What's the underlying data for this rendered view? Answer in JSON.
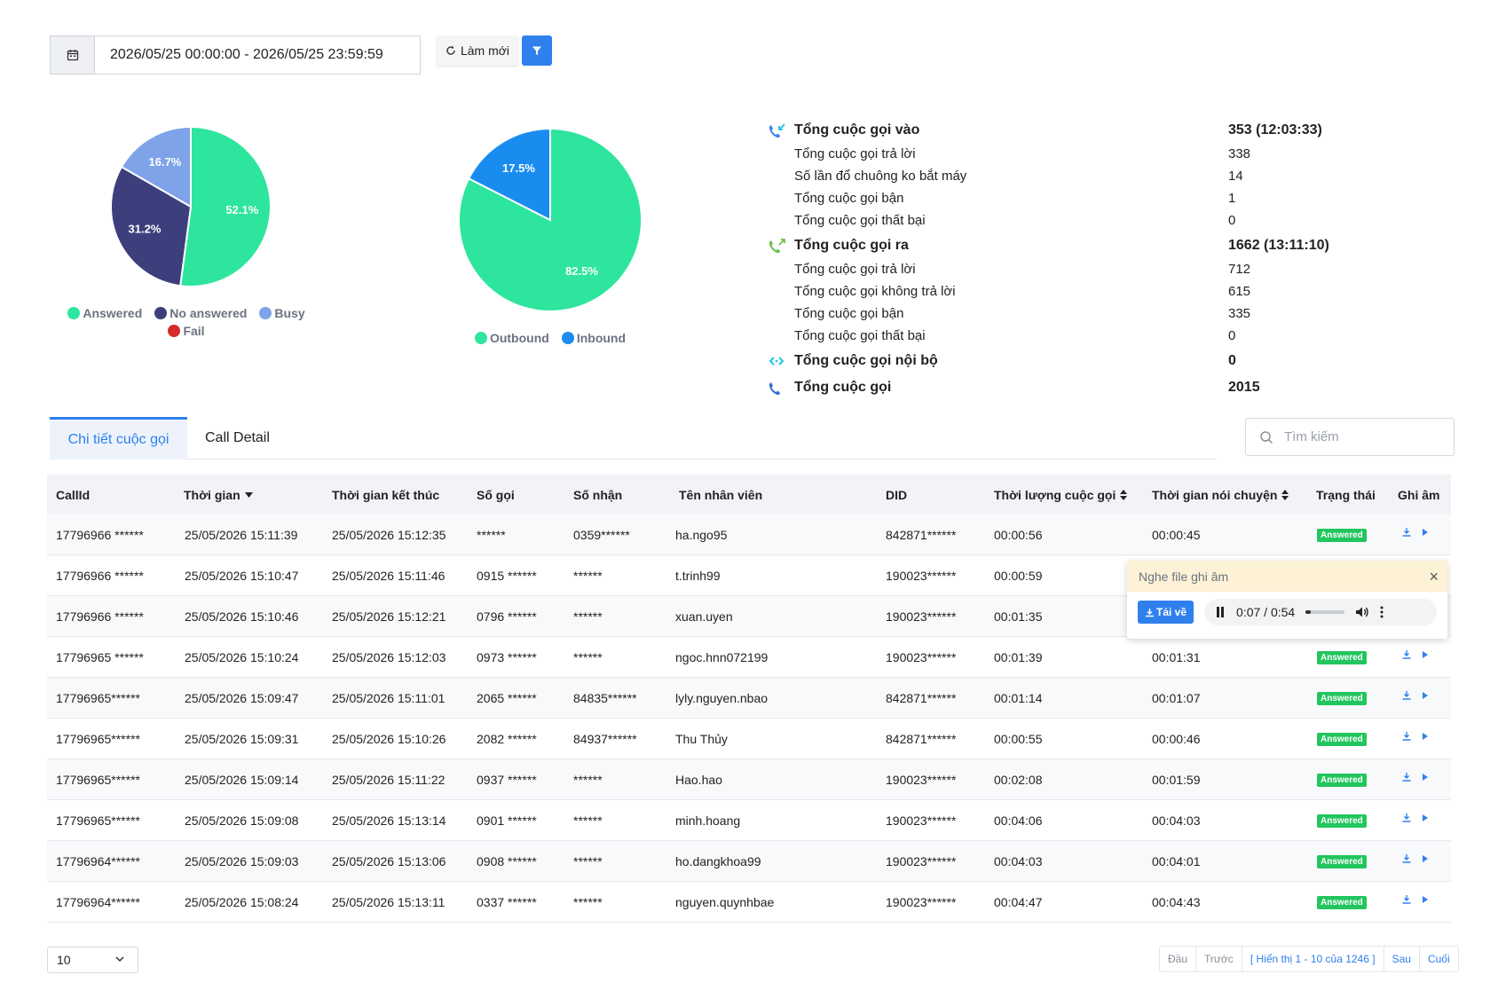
{
  "toolbar": {
    "date_range": "2026/05/25 00:00:00 - 2026/05/25 23:59:59",
    "refresh_label": "Làm mới"
  },
  "charts": {
    "status": {
      "slices": [
        {
          "name": "Answered",
          "pct": 52.1,
          "label": "52.1%",
          "color": "#2ee59d"
        },
        {
          "name": "No answered",
          "pct": 31.2,
          "label": "31.2%",
          "color": "#3d3f7d"
        },
        {
          "name": "Busy",
          "pct": 16.7,
          "label": "16.7%",
          "color": "#7ea3e8"
        },
        {
          "name": "Fail",
          "pct": 0,
          "label": "",
          "color": "#d62b2b"
        }
      ]
    },
    "direction": {
      "slices": [
        {
          "name": "Outbound",
          "pct": 82.5,
          "label": "82.5%",
          "color": "#2ee59d"
        },
        {
          "name": "Inbound",
          "pct": 17.5,
          "label": "17.5%",
          "color": "#1a8cf0"
        }
      ]
    }
  },
  "chart_data": [
    {
      "type": "pie",
      "categories": [
        "Answered",
        "No answered",
        "Busy",
        "Fail"
      ],
      "values": [
        52.1,
        31.2,
        16.7,
        0
      ],
      "title": "",
      "legend": "bottom"
    },
    {
      "type": "pie",
      "categories": [
        "Outbound",
        "Inbound"
      ],
      "values": [
        82.5,
        17.5
      ],
      "title": "",
      "legend": "bottom"
    }
  ],
  "stats": [
    {
      "label": "Tổng cuộc gọi vào",
      "value": "353 (12:03:33)",
      "head": true,
      "icon": "incoming-call-icon"
    },
    {
      "label": "Tổng cuộc gọi trả lời",
      "value": "338",
      "head": false
    },
    {
      "label": "Số lần đổ chuông ko bắt máy",
      "value": "14",
      "head": false
    },
    {
      "label": "Tổng cuộc gọi bận",
      "value": "1",
      "head": false
    },
    {
      "label": "Tổng cuộc gọi thất bại",
      "value": "0",
      "head": false
    },
    {
      "label": "Tổng cuộc gọi ra",
      "value": "1662 (13:11:10)",
      "head": true,
      "icon": "outgoing-call-icon"
    },
    {
      "label": "Tổng cuộc gọi trả lời",
      "value": "712",
      "head": false
    },
    {
      "label": "Tổng cuộc gọi không trả lời",
      "value": "615",
      "head": false
    },
    {
      "label": "Tổng cuộc gọi bận",
      "value": "335",
      "head": false
    },
    {
      "label": "Tổng cuộc gọi thất bại",
      "value": "0",
      "head": false
    },
    {
      "label": "Tổng cuộc gọi nội bộ",
      "value": "0",
      "head": true,
      "icon": "internal-call-icon"
    },
    {
      "label": "Tổng cuộc gọi",
      "value": "2015",
      "head": true,
      "icon": "phone-icon"
    }
  ],
  "tabs": {
    "active": "Chi tiết cuộc gọi",
    "other": "Call Detail"
  },
  "search": {
    "placeholder": "Tìm kiếm"
  },
  "table": {
    "headers": {
      "callid": "CallId",
      "time": "Thời gian",
      "end": "Thời gian kết thúc",
      "caller": "Số gọi",
      "callee": "Số nhận",
      "agent": "Tên nhân viên",
      "did": "DID",
      "duration": "Thời lượng cuộc gọi",
      "talk": "Thời gian nói chuyện",
      "status": "Trạng thái",
      "record": "Ghi âm"
    },
    "rows": [
      {
        "callid": "17796966 ******",
        "time": "25/05/2026 15:11:39",
        "end": "25/05/2026 15:12:35",
        "caller": "******",
        "callee": "0359******",
        "agent": "ha.ngo95",
        "did": "842871******",
        "duration": "00:00:56",
        "talk": "00:00:45",
        "status": "Answered"
      },
      {
        "callid": "17796966 ******",
        "time": "25/05/2026 15:10:47",
        "end": "25/05/2026 15:11:46",
        "caller": "0915 ******",
        "callee": "******",
        "agent": "t.trinh99",
        "did": "190023******",
        "duration": "00:00:59",
        "talk": "",
        "status": ""
      },
      {
        "callid": "17796966 ******",
        "time": "25/05/2026 15:10:46",
        "end": "25/05/2026 15:12:21",
        "caller": "0796 ******",
        "callee": "******",
        "agent": "xuan.uyen",
        "did": "190023******",
        "duration": "00:01:35",
        "talk": "",
        "status": ""
      },
      {
        "callid": "17796965 ******",
        "time": "25/05/2026 15:10:24",
        "end": "25/05/2026 15:12:03",
        "caller": "0973 ******",
        "callee": "******",
        "agent": "ngoc.hnn072199",
        "did": "190023******",
        "duration": "00:01:39",
        "talk": "00:01:31",
        "status": "Answered"
      },
      {
        "callid": "17796965******",
        "time": "25/05/2026 15:09:47",
        "end": "25/05/2026 15:11:01",
        "caller": "2065 ******",
        "callee": "84835******",
        "agent": "lyly.nguyen.nbao",
        "did": "842871******",
        "duration": "00:01:14",
        "talk": "00:01:07",
        "status": "Answered"
      },
      {
        "callid": "17796965******",
        "time": "25/05/2026 15:09:31",
        "end": "25/05/2026 15:10:26",
        "caller": "2082 ******",
        "callee": "84937******",
        "agent": "Thu Thủy",
        "did": "842871******",
        "duration": "00:00:55",
        "talk": "00:00:46",
        "status": "Answered"
      },
      {
        "callid": "17796965******",
        "time": "25/05/2026 15:09:14",
        "end": "25/05/2026 15:11:22",
        "caller": "0937 ******",
        "callee": "******",
        "agent": "Hao.hao",
        "did": "190023******",
        "duration": "00:02:08",
        "talk": "00:01:59",
        "status": "Answered"
      },
      {
        "callid": "17796965******",
        "time": "25/05/2026 15:09:08",
        "end": "25/05/2026 15:13:14",
        "caller": "0901 ******",
        "callee": "******",
        "agent": "minh.hoang",
        "did": "190023******",
        "duration": "00:04:06",
        "talk": "00:04:03",
        "status": "Answered"
      },
      {
        "callid": "17796964******",
        "time": "25/05/2026 15:09:03",
        "end": "25/05/2026 15:13:06",
        "caller": "0908 ******",
        "callee": "******",
        "agent": "ho.dangkhoa99",
        "did": "190023******",
        "duration": "00:04:03",
        "talk": "00:04:01",
        "status": "Answered"
      },
      {
        "callid": "17796964******",
        "time": "25/05/2026 15:08:24",
        "end": "25/05/2026 15:13:11",
        "caller": "0337 ******",
        "callee": "******",
        "agent": "nguyen.quynhbae",
        "did": "190023******",
        "duration": "00:04:47",
        "talk": "00:04:43",
        "status": "Answered"
      }
    ]
  },
  "audio_popup": {
    "title": "Nghe file ghi âm",
    "download_label": "Tải về",
    "time": "0:07 / 0:54",
    "progress": 0.13
  },
  "footer": {
    "page_size": "10",
    "pager": {
      "first": "Đầu",
      "prev": "Trước",
      "info": "[ Hiển thị 1 - 10 của 1246 ]",
      "next": "Sau",
      "last": "Cuối"
    }
  }
}
